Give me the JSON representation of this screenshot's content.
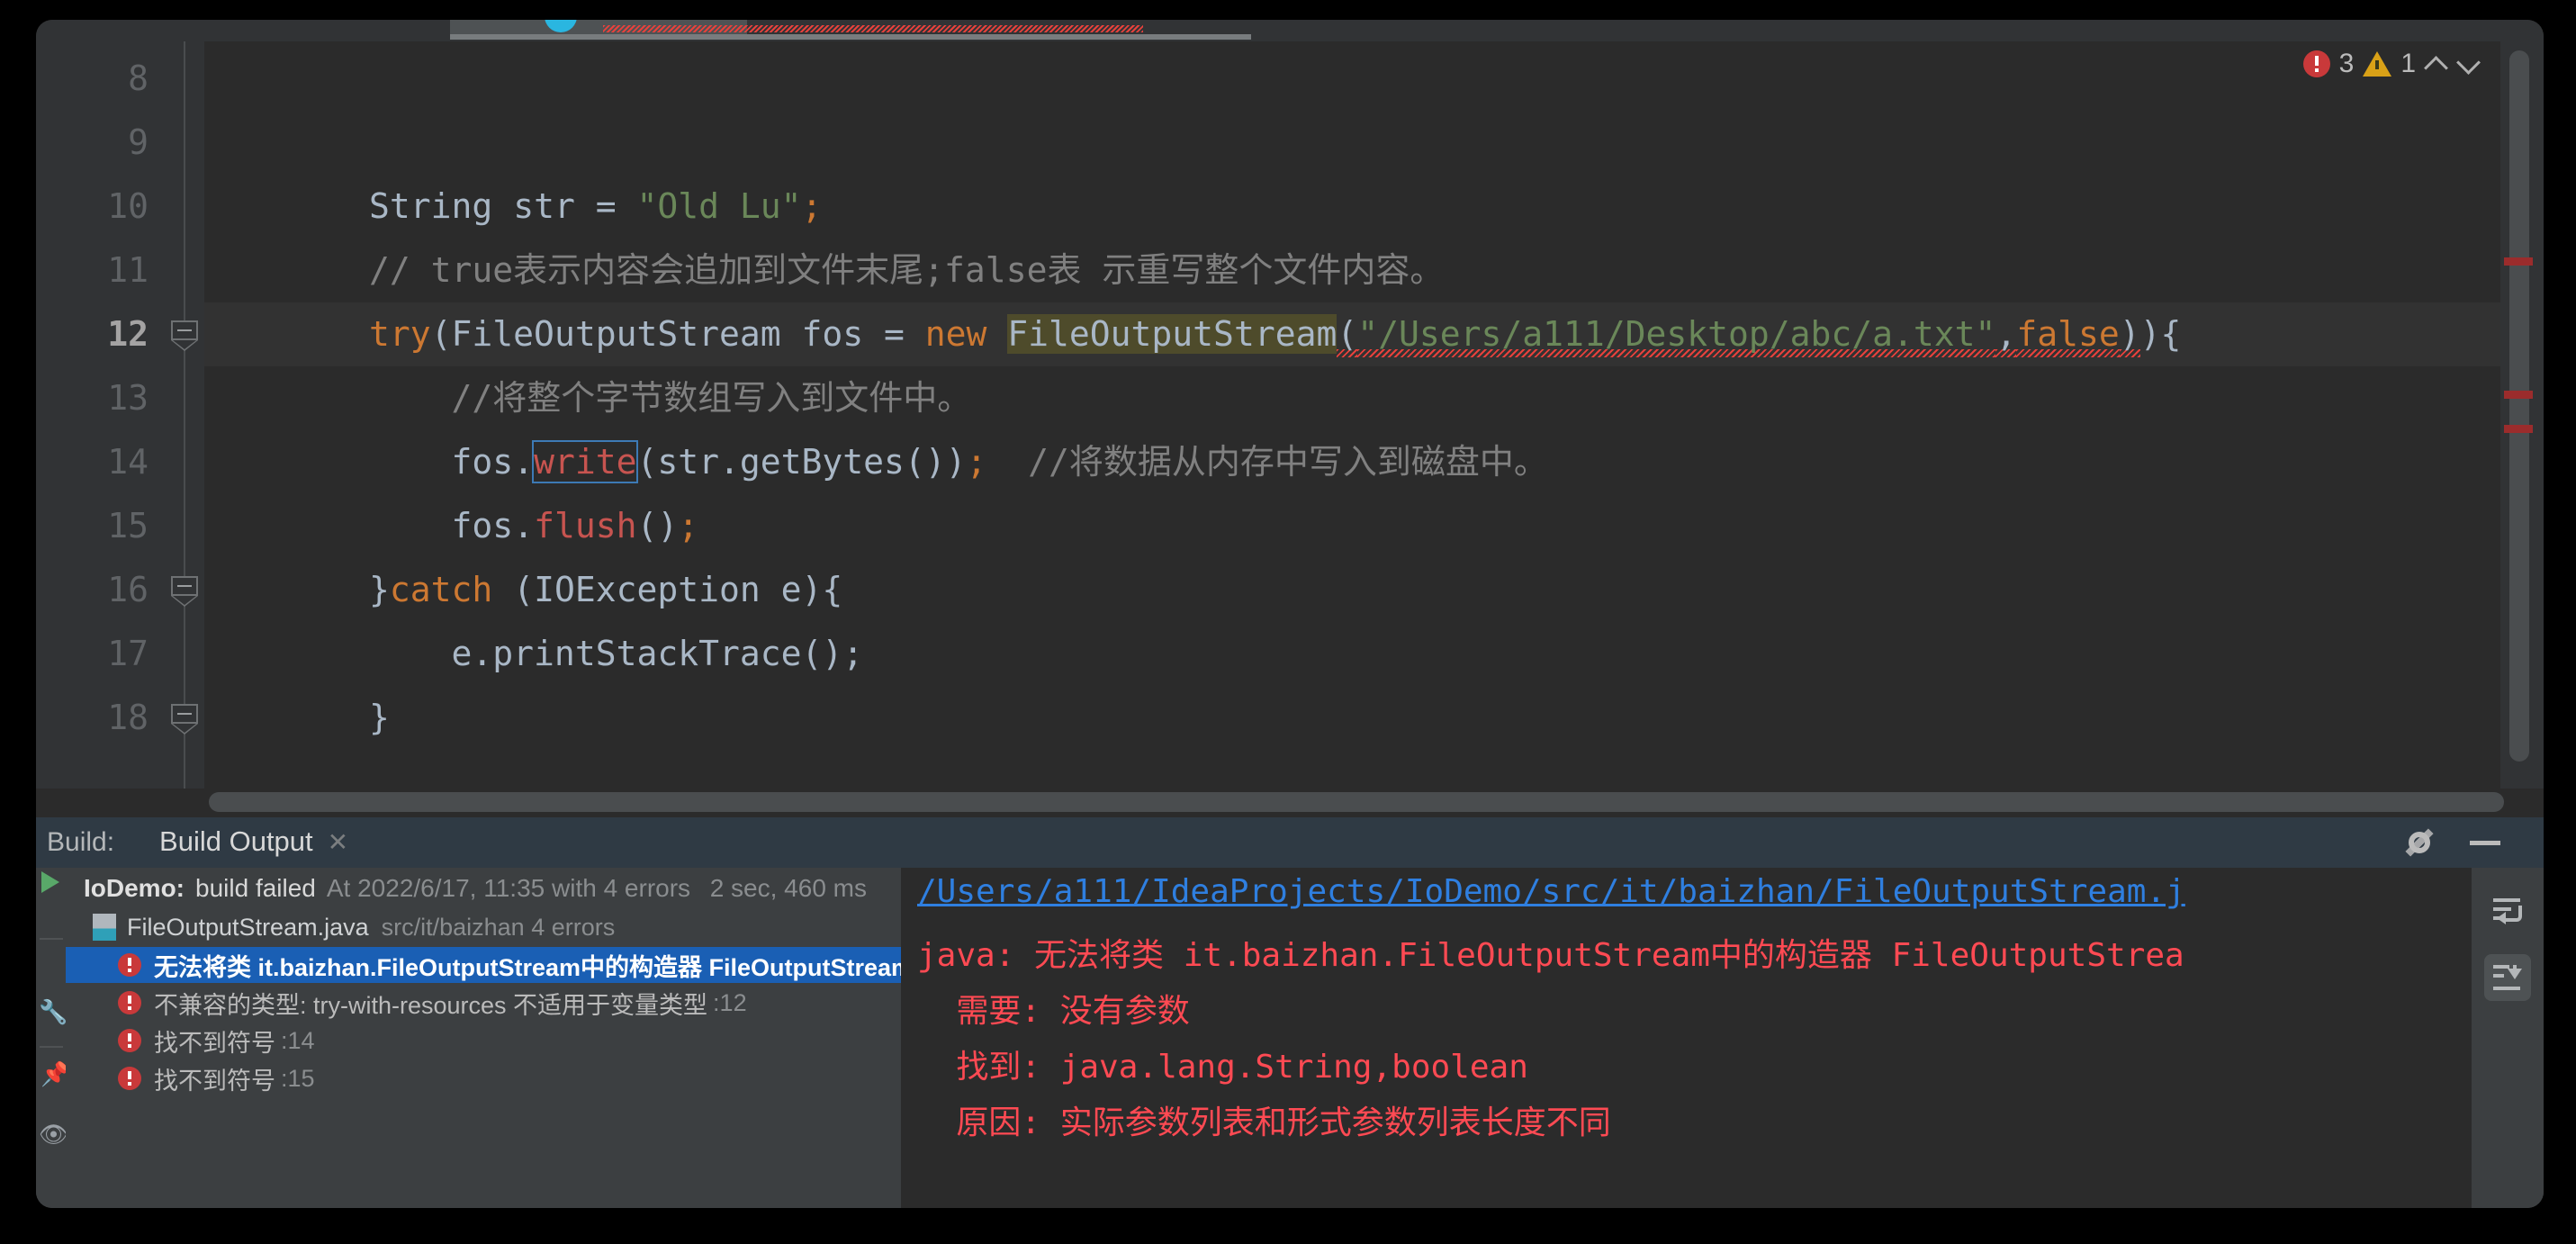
{
  "editor": {
    "gutter_lines": [
      "8",
      "9",
      "10",
      "11",
      "12",
      "13",
      "14",
      "15",
      "16",
      "17",
      "18"
    ],
    "current_line": "12",
    "inspections": {
      "error_count": "3",
      "warning_count": "1",
      "error_icon": "error-circle-icon",
      "warning_icon": "warning-triangle-icon",
      "prev_icon": "chevron-up-icon",
      "next_icon": "chevron-down-icon"
    },
    "code": [
      {
        "num": "8",
        "segments": []
      },
      {
        "num": "9",
        "segments": []
      },
      {
        "num": "10",
        "segments": [
          {
            "t": "        ",
            "c": "plain"
          },
          {
            "t": "String",
            "c": "plain"
          },
          {
            "t": " str = ",
            "c": "plain"
          },
          {
            "t": "\"Old Lu\"",
            "c": "str"
          },
          {
            "t": ";",
            "c": "kw"
          }
        ]
      },
      {
        "num": "11",
        "segments": [
          {
            "t": "        ",
            "c": "plain"
          },
          {
            "t": "// true表示内容会追加到文件末尾;false表 示重写整个文件内容。",
            "c": "cmt"
          }
        ]
      },
      {
        "num": "12",
        "segments": [
          {
            "t": "        ",
            "c": "plain"
          },
          {
            "t": "try",
            "c": "kw"
          },
          {
            "t": "(FileOutputStream fos = ",
            "c": "plain"
          },
          {
            "t": "new",
            "c": "kw"
          },
          {
            "t": " ",
            "c": "plain"
          },
          {
            "t": "FileOutputStream",
            "c": "hl-ident"
          },
          {
            "t": "(",
            "c": "plain-squig"
          },
          {
            "t": "\"/Users/a111/Desktop/abc/a.txt\"",
            "c": "str-squig"
          },
          {
            "t": ",",
            "c": "plain-squig"
          },
          {
            "t": "false",
            "c": "kw-squig"
          },
          {
            "t": ")",
            "c": "plain-squig"
          },
          {
            "t": "){",
            "c": "plain"
          }
        ]
      },
      {
        "num": "13",
        "segments": [
          {
            "t": "            ",
            "c": "plain"
          },
          {
            "t": "//将整个字节数组写入到文件中。",
            "c": "cmt"
          }
        ]
      },
      {
        "num": "14",
        "segments": [
          {
            "t": "            ",
            "c": "plain"
          },
          {
            "t": "fos.",
            "c": "plain"
          },
          {
            "t": "write",
            "c": "err-sel"
          },
          {
            "t": "(str.getBytes())",
            "c": "plain"
          },
          {
            "t": ";",
            "c": "kw"
          },
          {
            "t": "  ",
            "c": "plain"
          },
          {
            "t": "//将数据从内存中写入到磁盘中。",
            "c": "cmt"
          }
        ]
      },
      {
        "num": "15",
        "segments": [
          {
            "t": "            ",
            "c": "plain"
          },
          {
            "t": "fos.",
            "c": "plain"
          },
          {
            "t": "flush",
            "c": "err"
          },
          {
            "t": "()",
            "c": "plain"
          },
          {
            "t": ";",
            "c": "kw"
          }
        ]
      },
      {
        "num": "16",
        "segments": [
          {
            "t": "        ",
            "c": "plain"
          },
          {
            "t": "}",
            "c": "plain"
          },
          {
            "t": "catch",
            "c": "kw"
          },
          {
            "t": " (IOException e){",
            "c": "plain"
          }
        ]
      },
      {
        "num": "17",
        "segments": [
          {
            "t": "            ",
            "c": "plain"
          },
          {
            "t": "e.printStackTrace();",
            "c": "plain"
          }
        ]
      },
      {
        "num": "18",
        "segments": [
          {
            "t": "        ",
            "c": "plain"
          },
          {
            "t": "}",
            "c": "plain"
          }
        ]
      }
    ]
  },
  "build": {
    "window_label": "Build:",
    "tab_label": "Build Output",
    "tab_close_glyph": "✕",
    "gear_icon": "gear-icon",
    "minimize_icon": "minimize-icon",
    "summary": {
      "project": "IoDemo:",
      "status": "build failed",
      "meta": "At 2022/6/17, 11:35 with 4 errors",
      "duration": "2 sec, 460 ms"
    },
    "file_node": {
      "name": "FileOutputStream.java",
      "path": "src/it/baizhan",
      "errors": "4 errors",
      "icon": "java-file-icon"
    },
    "errors": [
      {
        "text": "无法将类 it.baizhan.FileOutputStream中的构造器 FileOutputStream应",
        "line": "",
        "selected": true
      },
      {
        "text": "不兼容的类型: try-with-resources 不适用于变量类型",
        "line": ":12",
        "selected": false
      },
      {
        "text": "找不到符号",
        "line": ":14",
        "selected": false
      },
      {
        "text": "找不到符号",
        "line": ":15",
        "selected": false
      }
    ],
    "detail": {
      "link": "/Users/a111/IdeaProjects/IoDemo/src/it/baizhan/FileOutputStream.j",
      "lines": [
        "java: 无法将类 it.baizhan.FileOutputStream中的构造器 FileOutputStrea",
        "  需要: 没有参数",
        "  找到: java.lang.String,boolean",
        "  原因: 实际参数列表和形式参数列表长度不同"
      ]
    },
    "tools": [
      {
        "name": "soft-wrap-icon",
        "active": false
      },
      {
        "name": "scroll-to-end-icon",
        "active": true
      }
    ],
    "rail": [
      {
        "name": "rerun-icon"
      },
      {
        "name": "settings-wrench-icon"
      },
      {
        "name": "pin-icon"
      },
      {
        "name": "filter-eye-icon"
      }
    ]
  },
  "colors": {
    "accent_blue": "#3d91e0",
    "selection_blue": "#1a5fb4",
    "error_red": "#ff4a53",
    "link_blue": "#2f7fe0",
    "keyword_orange": "#cc7832",
    "string_green": "#6a8759",
    "comment_gray": "#808080",
    "editor_bg": "#2b2b2b",
    "panel_bg": "#3c3f41"
  }
}
